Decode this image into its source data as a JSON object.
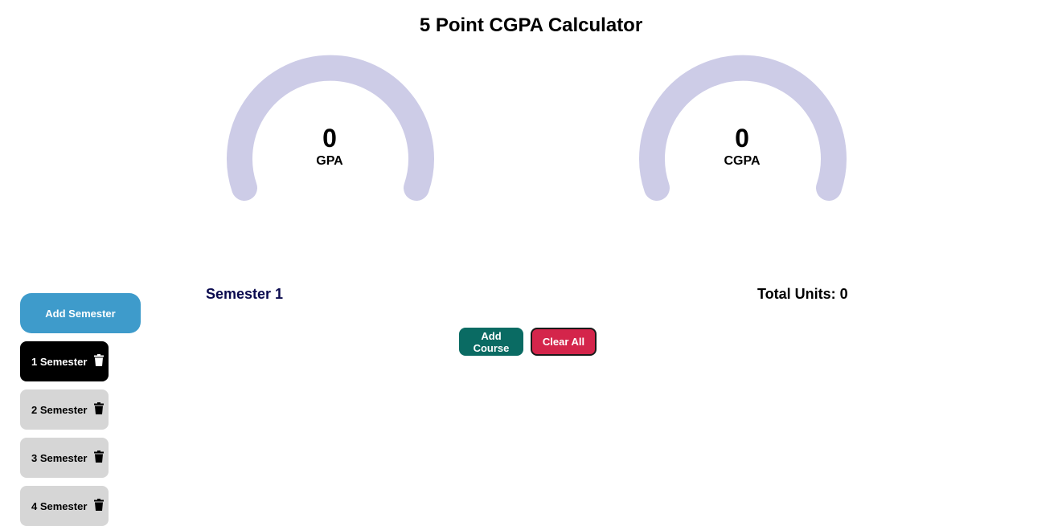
{
  "header": {
    "title": "5 Point CGPA Calculator"
  },
  "gauges": [
    {
      "value": "0",
      "label": "GPA",
      "track_color": "#cdcce7"
    },
    {
      "value": "0",
      "label": "CGPA",
      "track_color": "#cdcce7"
    }
  ],
  "sidebar": {
    "add_label": "Add Semester",
    "items": [
      {
        "label": "1 Semester",
        "active": true
      },
      {
        "label": "2 Semester"
      },
      {
        "label": "3 Semester"
      },
      {
        "label": "4 Semester"
      }
    ]
  },
  "main": {
    "semester_title": "Semester 1",
    "total_units": "Total Units: 0",
    "add_course_label": "Add Course",
    "clear_all_label": "Clear All"
  },
  "colors": {
    "accent": "#3e9bcb",
    "add_course": "#0a6b63",
    "clear_all": "#d4254b",
    "heading": "#0b0b4f"
  },
  "icons": {
    "delete": "trash-icon"
  }
}
